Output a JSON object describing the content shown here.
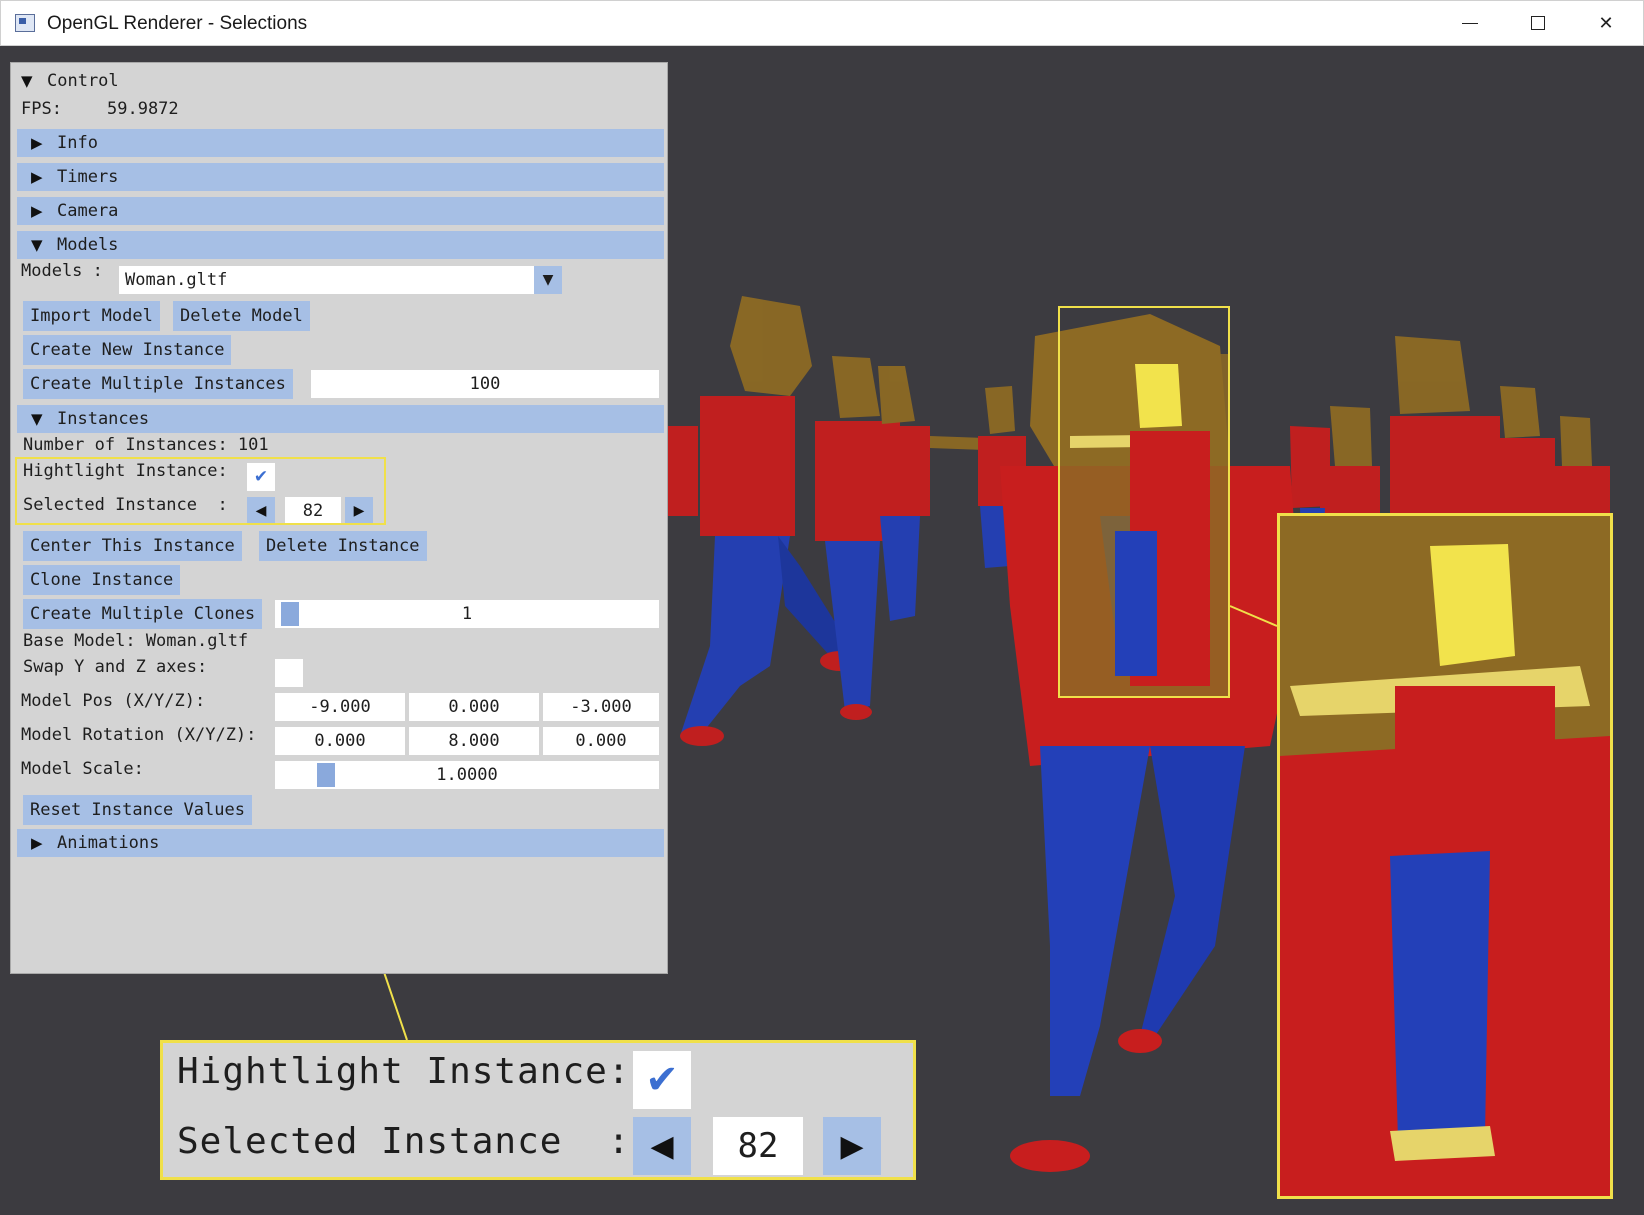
{
  "window": {
    "title": "OpenGL Renderer - Selections",
    "controls": {
      "minimize": "minimize",
      "maximize": "maximize",
      "close": "✕"
    }
  },
  "panel": {
    "header": "Control",
    "fps_label": "FPS:",
    "fps_value": "59.9872",
    "sections": {
      "info": "Info",
      "timers": "Timers",
      "camera": "Camera",
      "models": "Models",
      "instances": "Instances",
      "animations": "Animations"
    },
    "models": {
      "label": "Models :",
      "selected": "Woman.gltf",
      "import_button": "Import Model",
      "delete_button": "Delete Model",
      "create_instance_button": "Create New Instance",
      "create_multiple_button": "Create Multiple Instances",
      "create_multiple_value": "100"
    },
    "instances": {
      "count_label": "Number of Instances: 101",
      "highlight_label": "Hightlight Instance:",
      "highlight_checked": "✔",
      "selected_label": "Selected Instance  :",
      "selected_value": "82",
      "center_button": "Center This Instance",
      "delete_button": "Delete Instance",
      "clone_button": "Clone Instance",
      "clone_multiple_button": "Create Multiple Clones",
      "clone_multiple_value": "1",
      "base_model": "Base Model: Woman.gltf",
      "swap_axes_label": "Swap Y and Z axes:",
      "pos_label": "Model Pos (X/Y/Z):",
      "pos_values": [
        "-9.000",
        "0.000",
        "-3.000"
      ],
      "rot_label": "Model Rotation (X/Y/Z):",
      "rot_values": [
        "0.000",
        "8.000",
        "0.000"
      ],
      "scale_label": "Model Scale:",
      "scale_value": "1.0000",
      "reset_button": "Reset Instance Values"
    }
  },
  "zoom": {
    "highlight_label": "Hightlight Instance:",
    "highlight_checked": "✔",
    "selected_label": "Selected Instance  :",
    "selected_value": "82"
  },
  "colors": {
    "background": "#3c3b40",
    "panel": "#d4d4d4",
    "accent": "#a6bfe5",
    "highlight": "#f0e04a",
    "shirt": "#d8201f",
    "pants": "#2340b8",
    "skin_hair": "#8d6a24"
  }
}
